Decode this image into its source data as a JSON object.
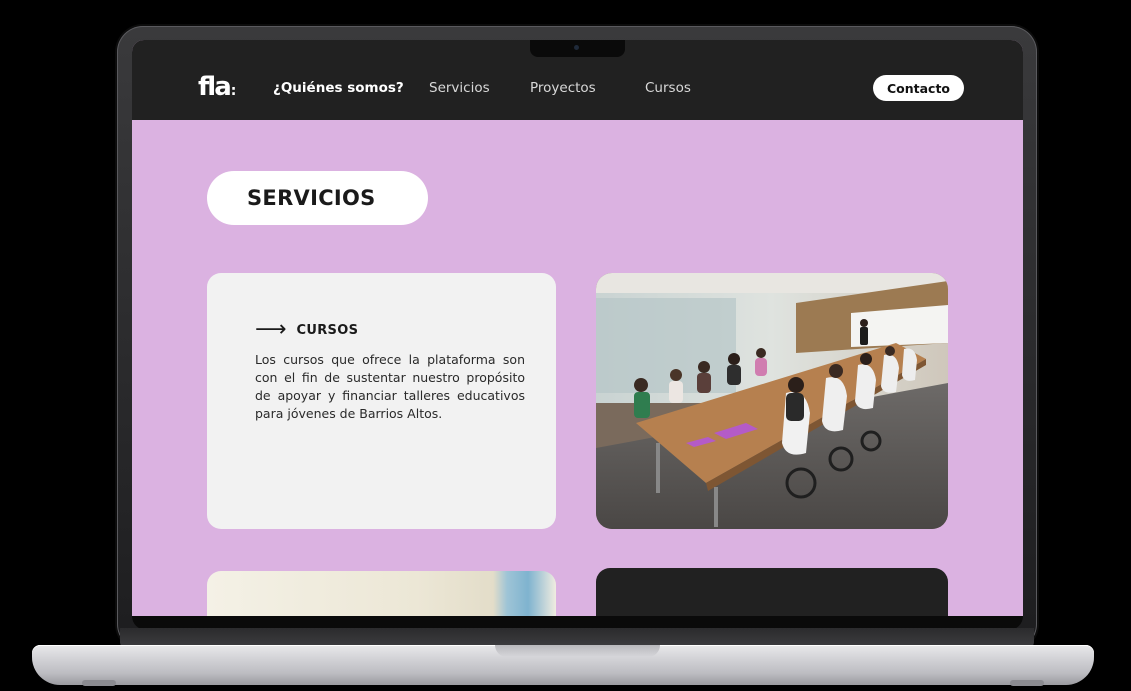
{
  "nav": {
    "logo_text": "fla",
    "logo_suffix": ":",
    "links": [
      {
        "label": "¿Quiénes somos?",
        "active": true
      },
      {
        "label": "Servicios",
        "active": false
      },
      {
        "label": "Proyectos",
        "active": false
      },
      {
        "label": "Cursos",
        "active": false
      }
    ],
    "contact_label": "Contacto"
  },
  "main": {
    "section_title": "SERVICIOS",
    "card": {
      "arrow": "⟶",
      "title": "CURSOS",
      "text": "Los cursos que ofrece la plataforma son con el fin de sustentar nuestro propósito de apoyar y financiar talleres educativos para jóvenes de Barrios Altos."
    }
  },
  "colors": {
    "page_background": "#dbb2e1",
    "nav_background": "#212121",
    "card_background": "#f2f2f2",
    "dark_card": "#212121"
  }
}
